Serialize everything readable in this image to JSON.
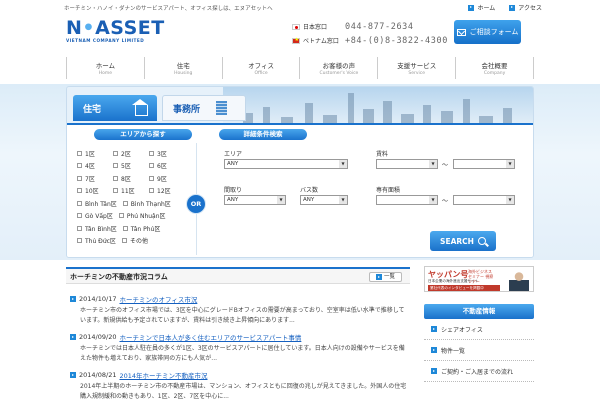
{
  "header": {
    "tagline": "ホーチミン・ハノイ・ダナンのサービスアパート、オフィス探しは、エヌアセットへ",
    "toplinks": [
      "ホーム",
      "アクセス"
    ],
    "logo": {
      "main_left": "N",
      "main_dot": "•",
      "main_right": "ASSET",
      "sub": "VIETNAM COMPANY LIMITED"
    },
    "contacts": [
      {
        "label": "日本窓口",
        "number": "044-877-2634",
        "flag": "jp"
      },
      {
        "label": "ベトナム窓口",
        "number": "+84-(0)8-3822-4300",
        "flag": "vn"
      }
    ],
    "consult_button": "ご相談フォーム"
  },
  "nav": [
    {
      "jp": "ホーム",
      "en": "Home"
    },
    {
      "jp": "住宅",
      "en": "Housing"
    },
    {
      "jp": "オフィス",
      "en": "Office"
    },
    {
      "jp": "お客様の声",
      "en": "Customer's Voice"
    },
    {
      "jp": "支援サービス",
      "en": "Service"
    },
    {
      "jp": "会社概要",
      "en": "Company"
    }
  ],
  "search": {
    "tabs": {
      "house": "住宅",
      "office": "事務所"
    },
    "area_heading": "エリアから探す",
    "detail_heading": "詳細条件検索",
    "or_label": "OR",
    "districts_numbered": [
      [
        "1区",
        "2区",
        "3区"
      ],
      [
        "4区",
        "5区",
        "6区"
      ],
      [
        "7区",
        "8区",
        "9区"
      ],
      [
        "10区",
        "11区",
        "12区"
      ]
    ],
    "districts_named": [
      [
        "Bình Tân区",
        "Bình Thạnh区"
      ],
      [
        "Gò Vấp区",
        "Phú Nhuận区"
      ],
      [
        "Tân Bình区",
        "Tân Phú区"
      ],
      [
        "Thủ Đức区",
        "その他"
      ]
    ],
    "fields": {
      "f1": {
        "label": "エリア",
        "value": "ANY"
      },
      "f2": {
        "label": "賃料",
        "value_from": "",
        "value_to": "",
        "tilde": "～"
      },
      "f3": {
        "label": "間取り",
        "value": "ANY"
      },
      "f4": {
        "label": "バス数",
        "value": "ANY"
      },
      "f5": {
        "label": "専有面積",
        "value_from": "",
        "value_to": "",
        "tilde": "～"
      }
    },
    "search_button": "SEARCH"
  },
  "column": {
    "title": "ホーチミンの不動産市況コラム",
    "list_button": "一覧",
    "articles": [
      {
        "date": "2014/10/17",
        "title": "ホーチミンのオフィス市況",
        "excerpt": "ホーチミン市のオフィス市場では、3区を中心にグレードBオフィスの需要が高まっており、空室率は低い水準で推移しています。新規供給も予定されていますが、賃料は引き続き上昇傾向にあります..."
      },
      {
        "date": "2014/09/20",
        "title": "ホーチミンで日本人が多く住むエリアのサービスアパート事情",
        "excerpt": "ホーチミンでは日本人駐在員の多くが1区、3区のサービスアパートに居住しています。日本人向けの設備やサービスを備えた物件も増えており、家族帯同の方にも人気が..."
      },
      {
        "date": "2014/08/21",
        "title": "2014年ホーチミン不動産市況",
        "excerpt": "2014年上半期のホーチミン市の不動産市場は、マンション、オフィスともに回復の兆しが見えてきました。外国人の住宅購入規制緩和の動きもあり、1区、2区、7区を中心に..."
      }
    ]
  },
  "sidebar": {
    "banner": {
      "logo": "ヤッパン号",
      "tag": "海外ビジネス セミナー 視察ツアー",
      "sub": "日本企業の海外進出支援サイト",
      "red": "業社代表のインタビューを掲載中"
    },
    "heading": "不動産情報",
    "items": [
      "シェアオフィス",
      "物件一覧",
      "ご契約・ご入居までの流れ"
    ]
  },
  "colors": {
    "accent": "#1a72cc",
    "link": "#1560c0",
    "brand": "#1a5fb4"
  }
}
